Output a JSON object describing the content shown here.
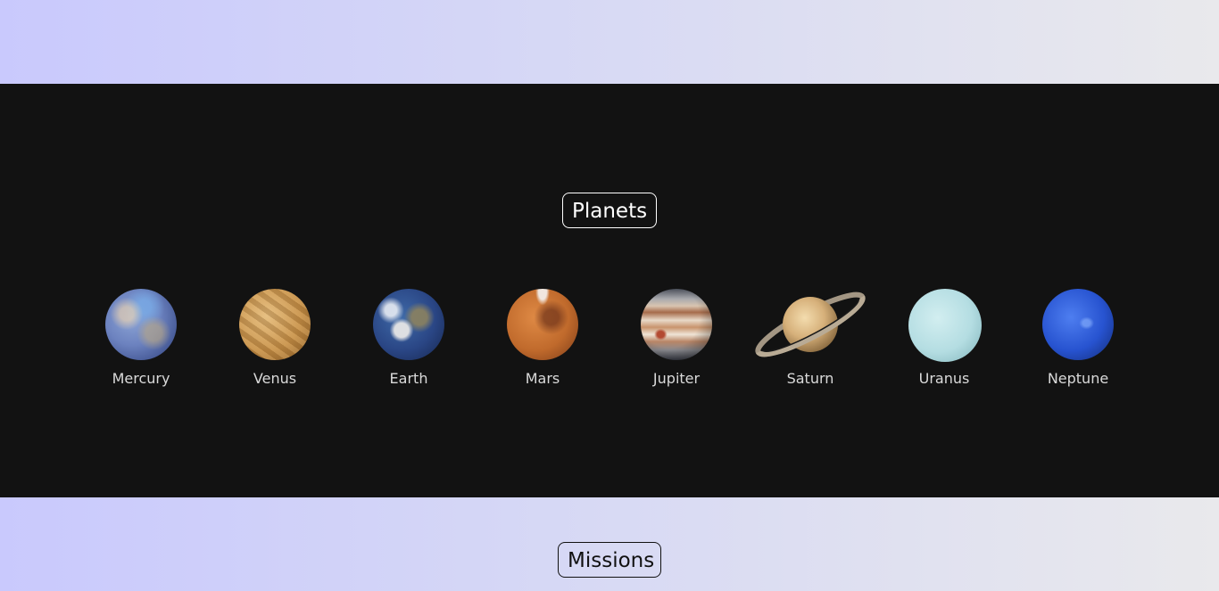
{
  "planets_section": {
    "heading": "Planets",
    "items": [
      {
        "name": "Mercury",
        "icon": "mercury-planet-image"
      },
      {
        "name": "Venus",
        "icon": "venus-planet-image"
      },
      {
        "name": "Earth",
        "icon": "earth-planet-image"
      },
      {
        "name": "Mars",
        "icon": "mars-planet-image"
      },
      {
        "name": "Jupiter",
        "icon": "jupiter-planet-image"
      },
      {
        "name": "Saturn",
        "icon": "saturn-planet-image"
      },
      {
        "name": "Uranus",
        "icon": "uranus-planet-image"
      },
      {
        "name": "Neptune",
        "icon": "neptune-planet-image"
      }
    ]
  },
  "missions_section": {
    "heading": "Missions"
  },
  "colors": {
    "band_gradient_start": "#c9c9fd",
    "band_gradient_end": "#e9e9ec",
    "planets_background": "#121212"
  }
}
